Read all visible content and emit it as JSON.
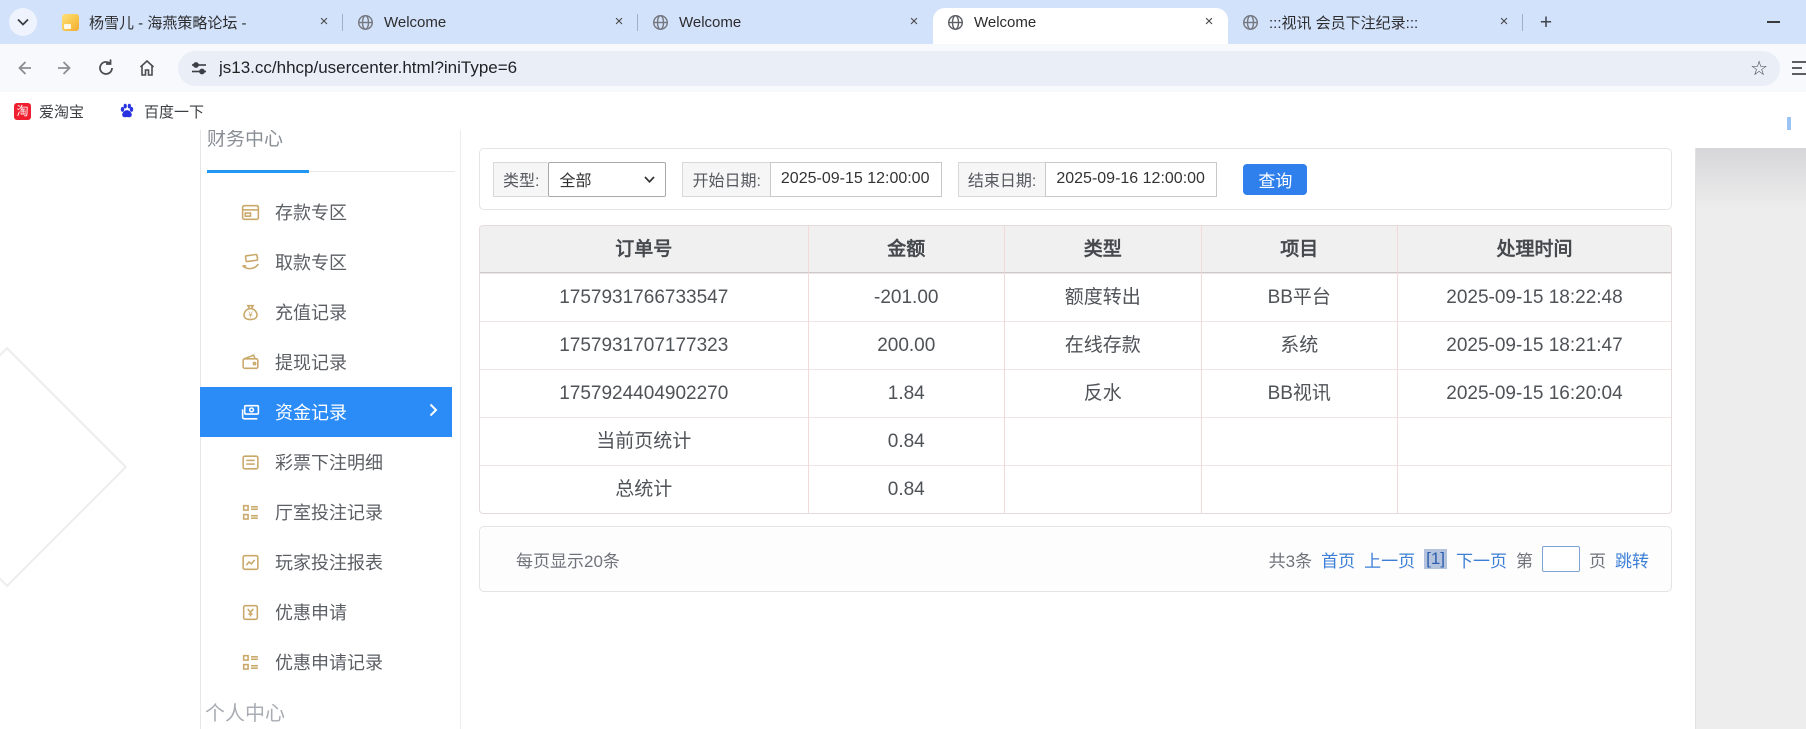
{
  "browser": {
    "tab_search_tooltip": "search-tabs",
    "tabs": [
      {
        "title": "杨雪儿 - 海燕策略论坛 -",
        "favicon": "doc-icon"
      },
      {
        "title": "Welcome",
        "favicon": "globe-icon"
      },
      {
        "title": "Welcome",
        "favicon": "globe-icon"
      },
      {
        "title": "Welcome",
        "favicon": "globe-icon",
        "active": true
      },
      {
        "title": ":::视讯 会员下注纪录:::",
        "favicon": "globe-icon"
      }
    ],
    "new_tab_label": "+",
    "url": "js13.cc/hhcp/usercenter.html?iniType=6",
    "bookmarks": [
      {
        "label": "爱淘宝",
        "icon": "taobao-icon",
        "icon_glyph": "淘"
      },
      {
        "label": "百度一下",
        "icon": "baidu-icon"
      }
    ]
  },
  "sidebar": {
    "section_finance": "财务中心",
    "section_personal": "个人中心",
    "items": [
      {
        "label": "存款专区",
        "icon": "deposit-card-icon"
      },
      {
        "label": "取款专区",
        "icon": "withdraw-hand-icon"
      },
      {
        "label": "充值记录",
        "icon": "money-bag-icon"
      },
      {
        "label": "提现记录",
        "icon": "wallet-icon"
      },
      {
        "label": "资金记录",
        "icon": "funds-cards-icon",
        "active": true
      },
      {
        "label": "彩票下注明细",
        "icon": "list-doc-icon"
      },
      {
        "label": "厅室投注记录",
        "icon": "detail-list-icon"
      },
      {
        "label": "玩家投注报表",
        "icon": "chart-report-icon"
      },
      {
        "label": "优惠申请",
        "icon": "promo-ticket-icon"
      },
      {
        "label": "优惠申请记录",
        "icon": "detail-list-icon"
      }
    ]
  },
  "filters": {
    "type_label": "类型:",
    "type_value": "全部",
    "start_label": "开始日期:",
    "start_value": "2025-09-15 12:00:00",
    "end_label": "结束日期:",
    "end_value": "2025-09-16 12:00:00",
    "query_label": "查询"
  },
  "table": {
    "headers": [
      "订单号",
      "金额",
      "类型",
      "项目",
      "处理时间"
    ],
    "rows": [
      [
        "1757931766733547",
        "-201.00",
        "额度转出",
        "BB平台",
        "2025-09-15 18:22:48"
      ],
      [
        "1757931707177323",
        "200.00",
        "在线存款",
        "系统",
        "2025-09-15 18:21:47"
      ],
      [
        "1757924404902270",
        "1.84",
        "反水",
        "BB视讯",
        "2025-09-15 16:20:04"
      ],
      [
        "当前页统计",
        "0.84",
        "",
        "",
        ""
      ],
      [
        "总统计",
        "0.84",
        "",
        "",
        ""
      ]
    ]
  },
  "pagination": {
    "page_size_text": "每页显示20条",
    "total_text": "共3条",
    "first": "首页",
    "prev": "上一页",
    "current": "[1]",
    "next": "下一页",
    "jump_prefix": "第",
    "jump_suffix": "页",
    "jump_label": "跳转",
    "jump_value": ""
  },
  "colors": {
    "accent_blue": "#2f80ed",
    "sidebar_active": "#2b8bf7",
    "icon_gold": "#c9a86a",
    "link_blue": "#3d7fd6",
    "tabstrip_bg": "#d3e2fb",
    "table_divider_pink": "#f2dada"
  }
}
